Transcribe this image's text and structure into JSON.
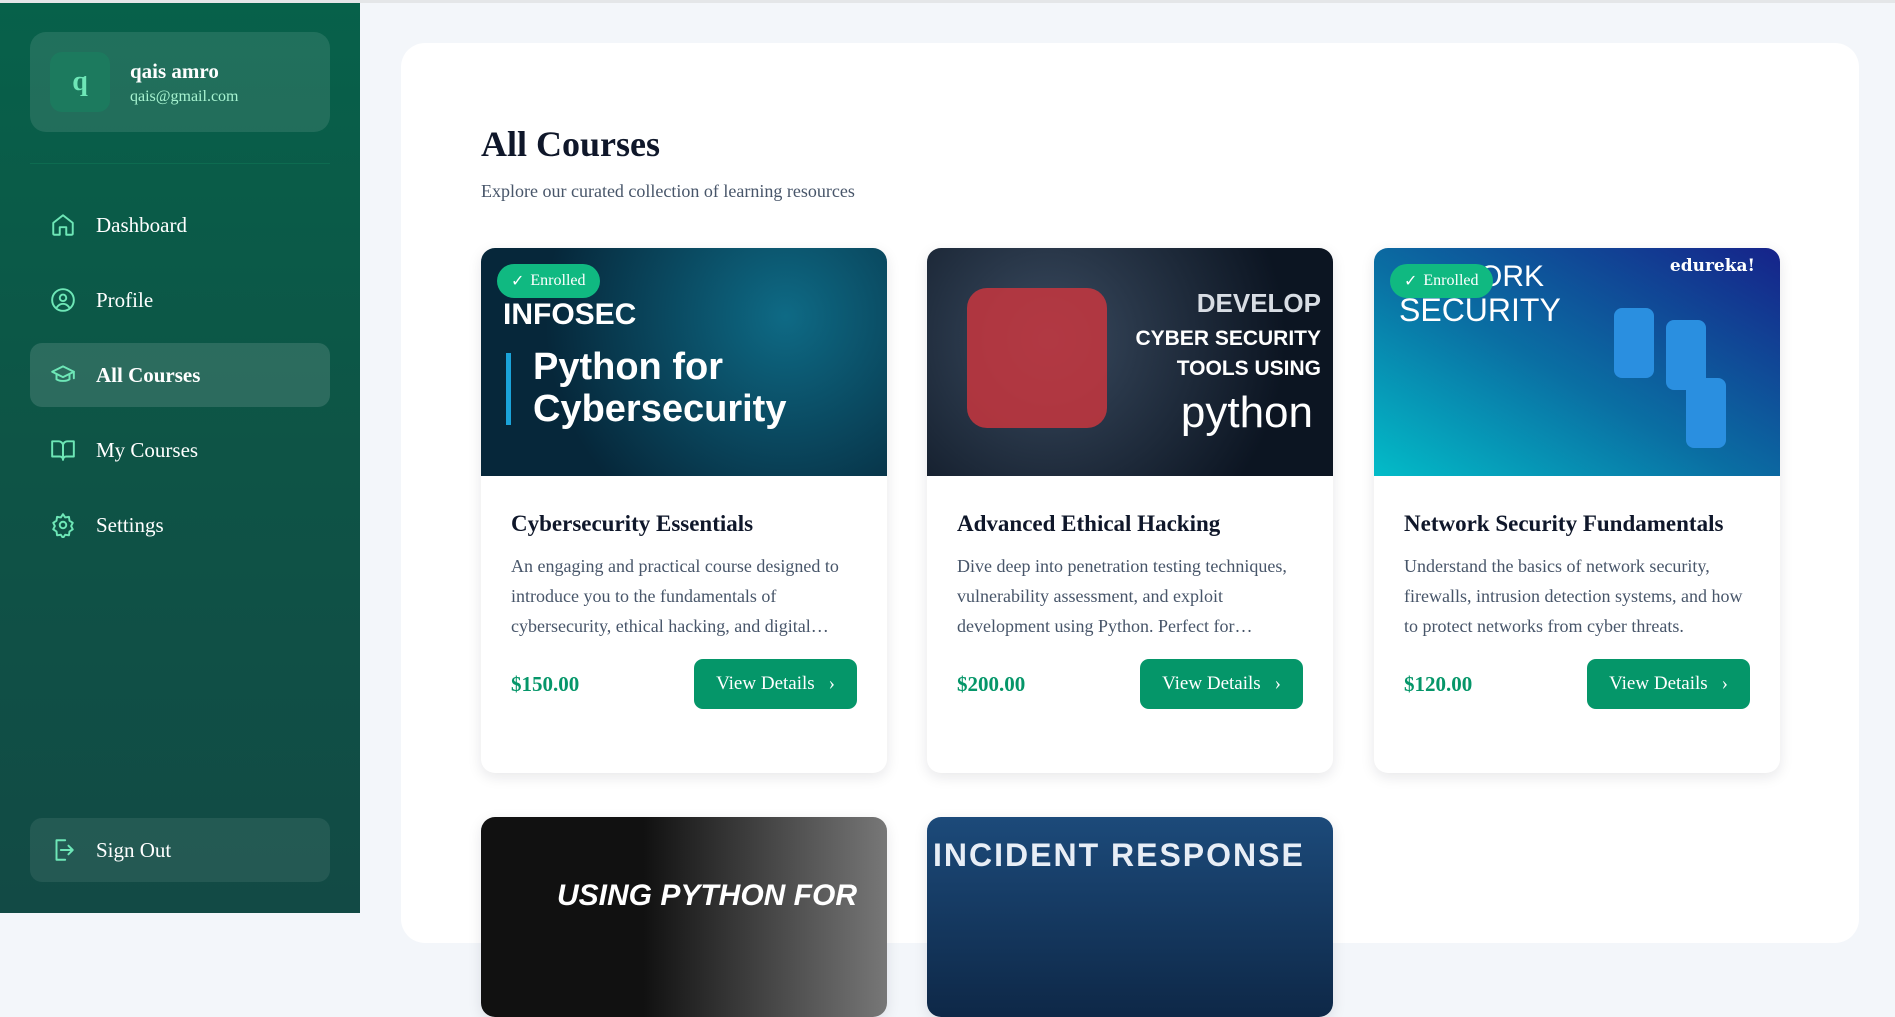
{
  "user": {
    "initial": "q",
    "name": "qais amro",
    "email": "qais@gmail.com"
  },
  "nav": [
    {
      "label": "Dashboard",
      "icon": "home-icon"
    },
    {
      "label": "Profile",
      "icon": "user-circle-icon"
    },
    {
      "label": "All Courses",
      "icon": "graduation-cap-icon",
      "active": true
    },
    {
      "label": "My Courses",
      "icon": "book-open-icon"
    },
    {
      "label": "Settings",
      "icon": "gear-icon"
    }
  ],
  "signout": "Sign Out",
  "page": {
    "title": "All Courses",
    "subtitle": "Explore our curated collection of learning resources"
  },
  "enrolled_label": "Enrolled",
  "view_label": "View Details",
  "courses": [
    {
      "title": "Cybersecurity Essentials",
      "desc": "An engaging and practical course designed to introduce you to the fundamentals of cybersecurity, ethical hacking, and digital security practices.",
      "price": "$150.00",
      "enrolled": true,
      "img_text": [
        "INFOSEC",
        "Python for Cybersecurity"
      ]
    },
    {
      "title": "Advanced Ethical Hacking",
      "desc": "Dive deep into penetration testing techniques, vulnerability assessment, and exploit development using Python. Perfect for advanced learners.",
      "price": "$200.00",
      "enrolled": false,
      "img_text": [
        "DEVELOP",
        "CYBER SECURITY TOOLS USING",
        "python"
      ]
    },
    {
      "title": "Network Security Fundamentals",
      "desc": "Understand the basics of network security, firewalls, intrusion detection systems, and how to protect networks from cyber threats.",
      "price": "$120.00",
      "enrolled": true,
      "img_text": [
        "ORK",
        "SECURITY",
        "edureka!"
      ]
    },
    {
      "img_text": [
        "USING PYTHON FOR"
      ]
    },
    {
      "img_text": [
        "INCIDENT RESPONSE"
      ]
    }
  ],
  "colors": {
    "accent": "#059669",
    "sidebar": "#07614a",
    "badge": "#10b981"
  }
}
